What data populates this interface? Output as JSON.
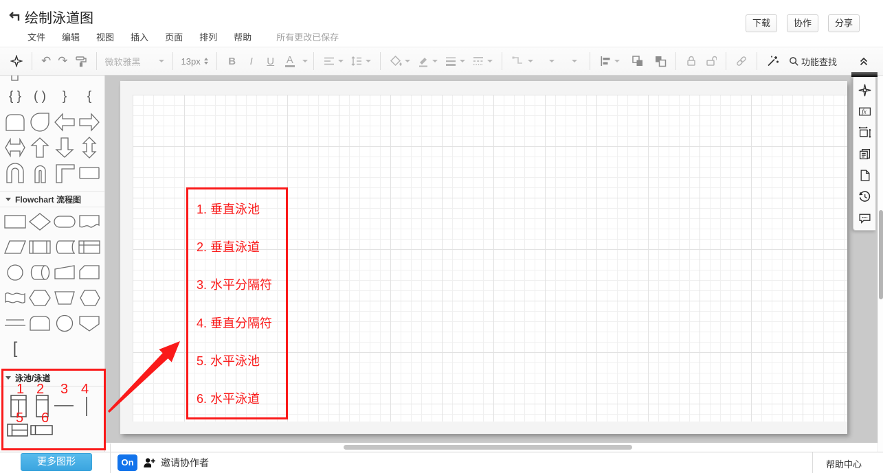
{
  "header": {
    "title": "绘制泳道图",
    "menus": [
      "文件",
      "编辑",
      "视图",
      "插入",
      "页面",
      "排列",
      "帮助"
    ],
    "save_status": "所有更改已保存",
    "action_buttons": [
      "下载",
      "协作",
      "分享"
    ]
  },
  "toolbar": {
    "font_name": "微软雅黑",
    "font_size": "13px",
    "style_buttons": {
      "bold": "B",
      "italic": "I",
      "underline": "U",
      "font_color": "A"
    },
    "search_label": "功能查找"
  },
  "sidebar": {
    "flowchart_section_title": "Flowchart 流程图",
    "swimlane_section_title": "泳池/泳道",
    "more_shapes_button": "更多图形"
  },
  "palette": {
    "top_rows": [
      [
        "bracket-bottom"
      ],
      [
        "brace-pair",
        "paren-pair",
        "brace-close",
        "brace-open"
      ],
      [
        "rounded-top-rect",
        "teardrop",
        "block-arrow-left",
        "block-arrow-right"
      ],
      [
        "block-arrow-left-right",
        "block-arrow-up",
        "block-arrow-down",
        "block-arrow-up-down"
      ],
      [
        "u-tube",
        "u-tube-narrow",
        "corner-shape",
        "rectangle"
      ]
    ],
    "flowchart_rows": [
      [
        "process-rect",
        "decision-diamond",
        "terminator-rounded",
        "document-wave"
      ],
      [
        "data-parallelogram",
        "predefined-process",
        "stored-data",
        "internal-storage"
      ],
      [
        "connector-circle",
        "direct-access-storage",
        "manual-operation",
        "card"
      ],
      [
        "wave-flag",
        "preparation-hexagon",
        "manual-input",
        "display-hexagon"
      ],
      [
        "divider-lines",
        "delay-rounded",
        "circle",
        "off-page-connector"
      ],
      [
        "open-bracket"
      ]
    ],
    "swimlane_items": [
      {
        "num": "1",
        "shape": "vertical-pool"
      },
      {
        "num": "2",
        "shape": "vertical-lane"
      },
      {
        "num": "3",
        "shape": "horizontal-separator"
      },
      {
        "num": "4",
        "shape": "vertical-separator"
      },
      {
        "num": "5",
        "shape": "horizontal-pool"
      },
      {
        "num": "6",
        "shape": "horizontal-lane"
      }
    ]
  },
  "canvas": {
    "annotation_list": [
      "1. 垂直泳池",
      "2. 垂直泳道",
      "3. 水平分隔符",
      "4. 垂直分隔符",
      "5. 水平泳池",
      "6. 水平泳道"
    ]
  },
  "status_bar": {
    "collab_toggle": "On",
    "invite_label": "邀请协作者",
    "help_center": "帮助中心"
  },
  "colors": {
    "annotation_red": "#fa1a1a",
    "more_shapes_blue": "#45b0e6",
    "collab_badge_blue": "#1273eb"
  }
}
